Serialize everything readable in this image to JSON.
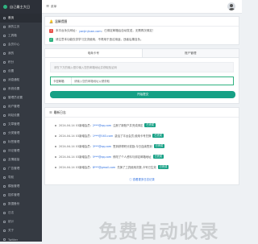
{
  "app": {
    "brand": "自己最主大日",
    "menu_toggle_label": "菜单"
  },
  "sidebar": {
    "items": [
      {
        "label": "首页"
      },
      {
        "label": "我的主页"
      },
      {
        "label": "工具箱"
      },
      {
        "label": "会员中心"
      },
      {
        "label": "我的"
      },
      {
        "label": "积分"
      },
      {
        "label": "设置"
      },
      {
        "label": "消息通知"
      },
      {
        "label": "系统设置"
      },
      {
        "label": "管理员设置"
      },
      {
        "label": "用户管理"
      },
      {
        "label": "网站设置"
      },
      {
        "label": "文章管理"
      },
      {
        "label": "分类管理"
      },
      {
        "label": "标签管理"
      },
      {
        "label": "评论管理"
      },
      {
        "label": "友情链接"
      },
      {
        "label": "广告管理"
      },
      {
        "label": "导航"
      },
      {
        "label": "模板管理"
      },
      {
        "label": "插件管理"
      },
      {
        "label": "数据备份"
      },
      {
        "label": "日志"
      },
      {
        "label": "统计"
      },
      {
        "label": "关于"
      },
      {
        "label": "Twitter"
      }
    ]
  },
  "notice": {
    "title": "温馨提醒",
    "row1_prefix": "本平台永久网址：",
    "row1_link": "yanjinjiuan.com",
    "row1_suffix": "，已绑定邮箱后自动发送，无需再次绑定！",
    "row2_text": "请注意本功能仅供学习交流使用，不得用于违法用途，违者后果自负。"
  },
  "form": {
    "tab1": "电商卡号",
    "tab2": "账户管理",
    "hint": "请在下方的输入框中输入您的邮箱地址并获取验证码",
    "field_label": "卡密邮箱",
    "field_placeholder": "请输入您的邮箱地址以便获取",
    "submit": "开始提交"
  },
  "log": {
    "title": "最新日志",
    "entries": [
      {
        "time": "2024-04-14 03",
        "action": "新增会员:",
        "email": "2***@qq.com",
        "note": "注册了新账户并完成绑定",
        "badge": "已完成"
      },
      {
        "time": "2024-04-14 03",
        "action": "新增会员:",
        "email": "1***@163.com",
        "note": "激活了平台会员,使用卡号兑换",
        "badge": "已完成"
      },
      {
        "time": "2024-04-14 03",
        "action": "新增会员:",
        "email": "3***@qq.com",
        "note": "签到获得积分奖励,今日连续签到",
        "badge": "已完成"
      },
      {
        "time": "2024-04-14 03",
        "action": "新增会员:",
        "email": "5***@qq.com",
        "note": "修改了个人资料与绑定邮箱地址",
        "badge": "已完成"
      },
      {
        "time": "2024-04-14 03",
        "action": "新增会员:",
        "email": "8***@gmail.com",
        "note": "兑换了工具使用次数,卡号已生效",
        "badge": "已完成"
      }
    ],
    "more": "ⓘ 查看更多日志记录"
  },
  "watermark": "免费自动收录",
  "icons": {
    "bell": "bell-icon",
    "list": "list-icon",
    "menu": "menu-icon"
  },
  "colors": {
    "accent": "#16a085",
    "sidebar": "#353a42",
    "link": "#2b6de0"
  }
}
